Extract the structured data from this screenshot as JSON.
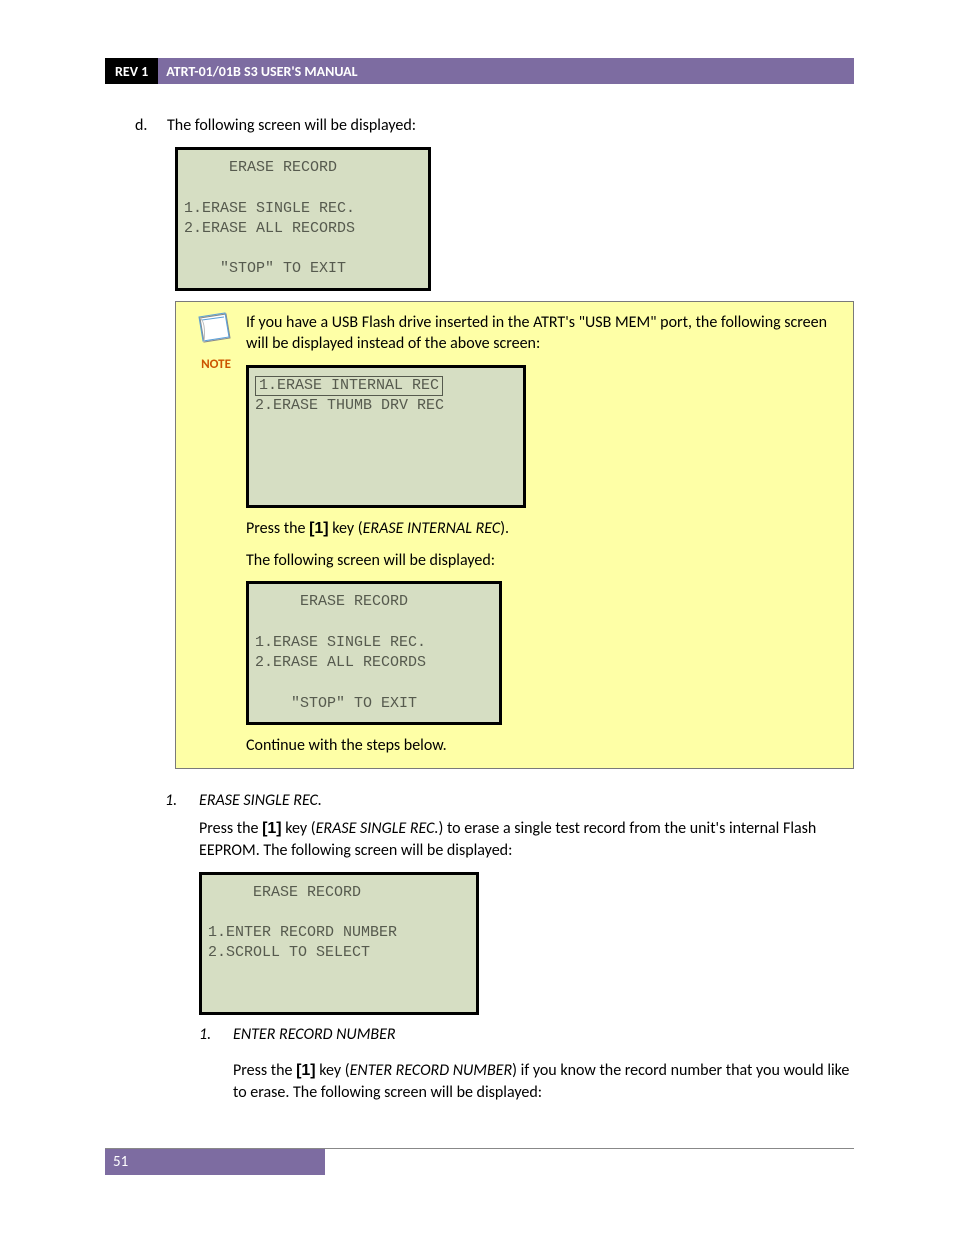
{
  "header": {
    "rev": "REV 1",
    "title": "ATRT-01/01B S3 USER'S MANUAL"
  },
  "step_d": {
    "marker": "d.",
    "text": "The following screen will be displayed:"
  },
  "lcd1": {
    "title": "     ERASE RECORD",
    "line1": "1.ERASE SINGLE REC.",
    "line2": "2.ERASE ALL RECORDS",
    "footer": "    \"STOP\" TO EXIT"
  },
  "note": {
    "label": "NOTE",
    "intro": "If you have a USB Flash drive inserted in the ATRT's \"USB MEM\" port, the following screen will be displayed instead of the above screen:",
    "lcd2_line1": "1.ERASE INTERNAL REC",
    "lcd2_line2": "2.ERASE THUMB DRV REC",
    "press_pre": "Press the ",
    "press_key": "[1]",
    "press_mid": " key (",
    "press_opt": "ERASE INTERNAL REC",
    "press_post": ").",
    "following": "The following screen will be displayed:",
    "lcd3_title": "     ERASE RECORD",
    "lcd3_line1": "1.ERASE SINGLE REC.",
    "lcd3_line2": "2.ERASE ALL RECORDS",
    "lcd3_footer": "    \"STOP\" TO EXIT",
    "continue": "Continue with the steps below."
  },
  "opt1": {
    "num": "1.",
    "head": "ERASE SINGLE REC.",
    "body_pre": "Press the ",
    "body_key": "[1]",
    "body_mid": " key (",
    "body_opt": "ERASE SINGLE REC.",
    "body_post": ") to erase a single test record from the unit's internal Flash EEPROM. The following screen will be displayed:",
    "lcd4_title": "     ERASE RECORD",
    "lcd4_line1": "1.ENTER RECORD NUMBER",
    "lcd4_line2": "2.SCROLL TO SELECT"
  },
  "opt1_1": {
    "num": "1.",
    "head": "ENTER RECORD NUMBER",
    "body_pre": "Press the ",
    "body_key": "[1]",
    "body_mid": " key (",
    "body_opt": "ENTER RECORD NUMBER",
    "body_post": ") if you know the record number that you would like to erase. The following screen will be displayed:"
  },
  "footer": {
    "page": "51"
  }
}
